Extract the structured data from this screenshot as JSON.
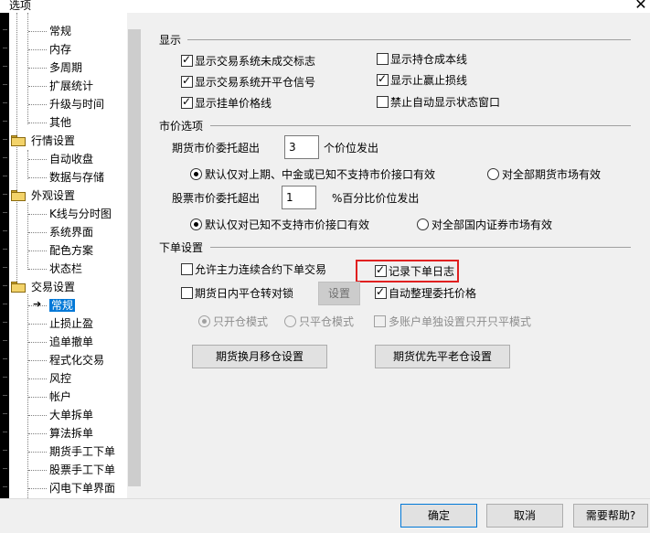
{
  "window": {
    "title": "选项",
    "close_glyph": "✕"
  },
  "tree": {
    "items": [
      {
        "label": "常规",
        "indent": 1
      },
      {
        "label": "内存",
        "indent": 1
      },
      {
        "label": "多周期",
        "indent": 1
      },
      {
        "label": "扩展统计",
        "indent": 1
      },
      {
        "label": "升级与时间",
        "indent": 1
      },
      {
        "label": "其他",
        "indent": 1
      },
      {
        "label": "行情设置",
        "indent": 0,
        "folder": true
      },
      {
        "label": "自动收盘",
        "indent": 1
      },
      {
        "label": "数据与存储",
        "indent": 1
      },
      {
        "label": "外观设置",
        "indent": 0,
        "folder": true
      },
      {
        "label": "K线与分时图",
        "indent": 1
      },
      {
        "label": "系统界面",
        "indent": 1
      },
      {
        "label": "配色方案",
        "indent": 1
      },
      {
        "label": "状态栏",
        "indent": 1
      },
      {
        "label": "交易设置",
        "indent": 0,
        "folder": true
      },
      {
        "label": "常规",
        "indent": 1,
        "selected": true
      },
      {
        "label": "止损止盈",
        "indent": 1
      },
      {
        "label": "追单撤单",
        "indent": 1
      },
      {
        "label": "程式化交易",
        "indent": 1
      },
      {
        "label": "风控",
        "indent": 1
      },
      {
        "label": "帐户",
        "indent": 1
      },
      {
        "label": "大单拆单",
        "indent": 1
      },
      {
        "label": "算法拆单",
        "indent": 1
      },
      {
        "label": "期货手工下单",
        "indent": 1
      },
      {
        "label": "股票手工下单",
        "indent": 1
      },
      {
        "label": "闪电下单界面",
        "indent": 1
      }
    ]
  },
  "display": {
    "header": "显示",
    "opt_unfilled_marker": {
      "label": "显示交易系统未成交标志",
      "checked": true
    },
    "opt_open_close_signal": {
      "label": "显示交易系统开平仓信号",
      "checked": true
    },
    "opt_order_price_line": {
      "label": "显示挂单价格线",
      "checked": true
    },
    "opt_position_cost_line": {
      "label": "显示持仓成本线",
      "checked": false
    },
    "opt_tp_sl_line": {
      "label": "显示止赢止损线",
      "checked": true
    },
    "opt_disable_status_window": {
      "label": "禁止自动显示状态窗口",
      "checked": false
    }
  },
  "market_price": {
    "header": "市价选项",
    "futures_label": "期货市价委托超出",
    "futures_value": "3",
    "futures_suffix": "个价位发出",
    "futures_radio_a": {
      "label": "默认仅对上期、中金或已知不支持市价接口有效",
      "on": true
    },
    "futures_radio_b": {
      "label": "对全部期货市场有效",
      "on": false
    },
    "stock_label": "股票市价委托超出",
    "stock_value": "1",
    "stock_suffix": "%百分比价位发出",
    "stock_radio_a": {
      "label": "默认仅对已知不支持市价接口有效",
      "on": true
    },
    "stock_radio_b": {
      "label": "对全部国内证券市场有效",
      "on": false
    }
  },
  "order_settings": {
    "header": "下单设置",
    "opt_main_contract": {
      "label": "允许主力连续合约下单交易",
      "checked": false
    },
    "opt_record_log": {
      "label": "记录下单日志",
      "checked": true
    },
    "opt_intraday_lock": {
      "label": "期货日内平仓转对锁",
      "checked": false
    },
    "setup_button": "设置",
    "opt_auto_tidy": {
      "label": "自动整理委托价格",
      "checked": true
    },
    "mode_open_only": {
      "label": "只开仓模式",
      "on": true
    },
    "mode_close_only": {
      "label": "只平仓模式",
      "on": false
    },
    "opt_multi_account": {
      "label": "多账户单独设置只开只平模式",
      "checked": false
    },
    "btn_rollover": "期货换月移仓设置",
    "btn_close_old_first": "期货优先平老仓设置"
  },
  "footer": {
    "ok": "确定",
    "cancel": "取消",
    "help": "需要帮助?"
  }
}
